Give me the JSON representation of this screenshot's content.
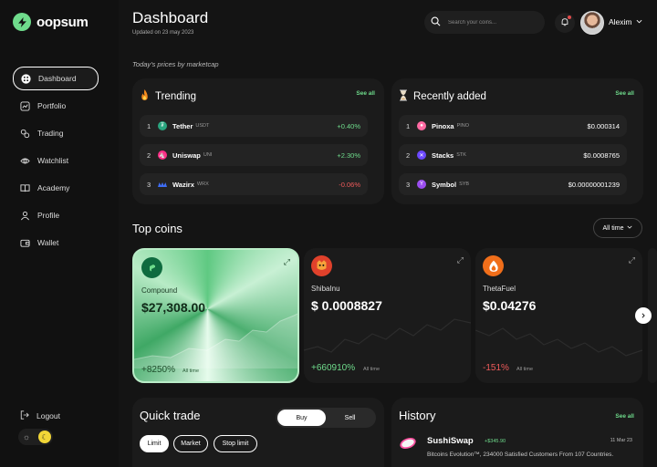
{
  "app": {
    "name": "oopsum"
  },
  "sidebar": {
    "items": [
      {
        "label": "Dashboard",
        "icon": "grid-icon",
        "active": true
      },
      {
        "label": "Portfolio",
        "icon": "chart-icon"
      },
      {
        "label": "Trading",
        "icon": "trading-icon"
      },
      {
        "label": "Watchlist",
        "icon": "eye-icon"
      },
      {
        "label": "Academy",
        "icon": "book-icon"
      },
      {
        "label": "Profile",
        "icon": "user-icon"
      },
      {
        "label": "Wallet",
        "icon": "wallet-icon"
      }
    ],
    "logout": "Logout",
    "theme_toggle": {
      "icons": [
        "sun-icon",
        "moon-icon"
      ],
      "active": "moon"
    }
  },
  "header": {
    "title": "Dashboard",
    "updated": "Updated on 23 may 2023",
    "search_placeholder": "Search your coins...",
    "user_name": "Alexim"
  },
  "prices_caption": "Today's prices by marketcap",
  "trending": {
    "title": "Trending",
    "see_all": "See all",
    "rows": [
      {
        "rank": "1",
        "name": "Tether",
        "symbol": "USDT",
        "value": "+0.40%",
        "color": "#2aa57f"
      },
      {
        "rank": "2",
        "name": "Uniswap",
        "symbol": "UNI",
        "value": "+2.30%",
        "color": "#ff2d87"
      },
      {
        "rank": "3",
        "name": "Wazirx",
        "symbol": "WRX",
        "value": "-0.06%",
        "color": "#3e6df6"
      }
    ]
  },
  "recent": {
    "title": "Recently added",
    "see_all": "See all",
    "rows": [
      {
        "rank": "1",
        "name": "Pinoxa",
        "symbol": "PINO",
        "value": "$0.000314",
        "color": "#ff6aa2"
      },
      {
        "rank": "2",
        "name": "Stacks",
        "symbol": "STK",
        "value": "$0.0008765",
        "color": "#6b48ff"
      },
      {
        "rank": "3",
        "name": "Symbol",
        "symbol": "SYB",
        "value": "$0.00000001239",
        "color": "#9b4df0"
      }
    ]
  },
  "top_coins": {
    "title": "Top coins",
    "range": "All time",
    "cards": [
      {
        "name": "Compound",
        "price": "$27,308.00",
        "change": "+8250%",
        "period": "All time",
        "icon_color": "#0f6b3f"
      },
      {
        "name": "ShibaInu",
        "price": "$ 0.0008827",
        "change": "+660910%",
        "period": "All time",
        "icon_color": "#e0412b"
      },
      {
        "name": "ThetaFuel",
        "price": "$0.04276",
        "change": "-151%",
        "period": "All time",
        "icon_color": "#f06e1a"
      }
    ]
  },
  "quick_trade": {
    "title": "Quick trade",
    "buy": "Buy",
    "sell": "Sell",
    "orders": [
      "Limit",
      "Market",
      "Stop limit"
    ]
  },
  "history": {
    "title": "History",
    "see_all": "See all",
    "item": {
      "name": "SushiSwap",
      "amount": "+$345.90",
      "date": "11 Mar 23",
      "desc": "Bitcoins Evolution™, 234000 Satisfied Customers From 107 Countries."
    }
  },
  "colors": {
    "accent": "#6fdc8c",
    "negative": "#ef5b5b",
    "background": "#141414",
    "panel": "#1b1b1b"
  }
}
